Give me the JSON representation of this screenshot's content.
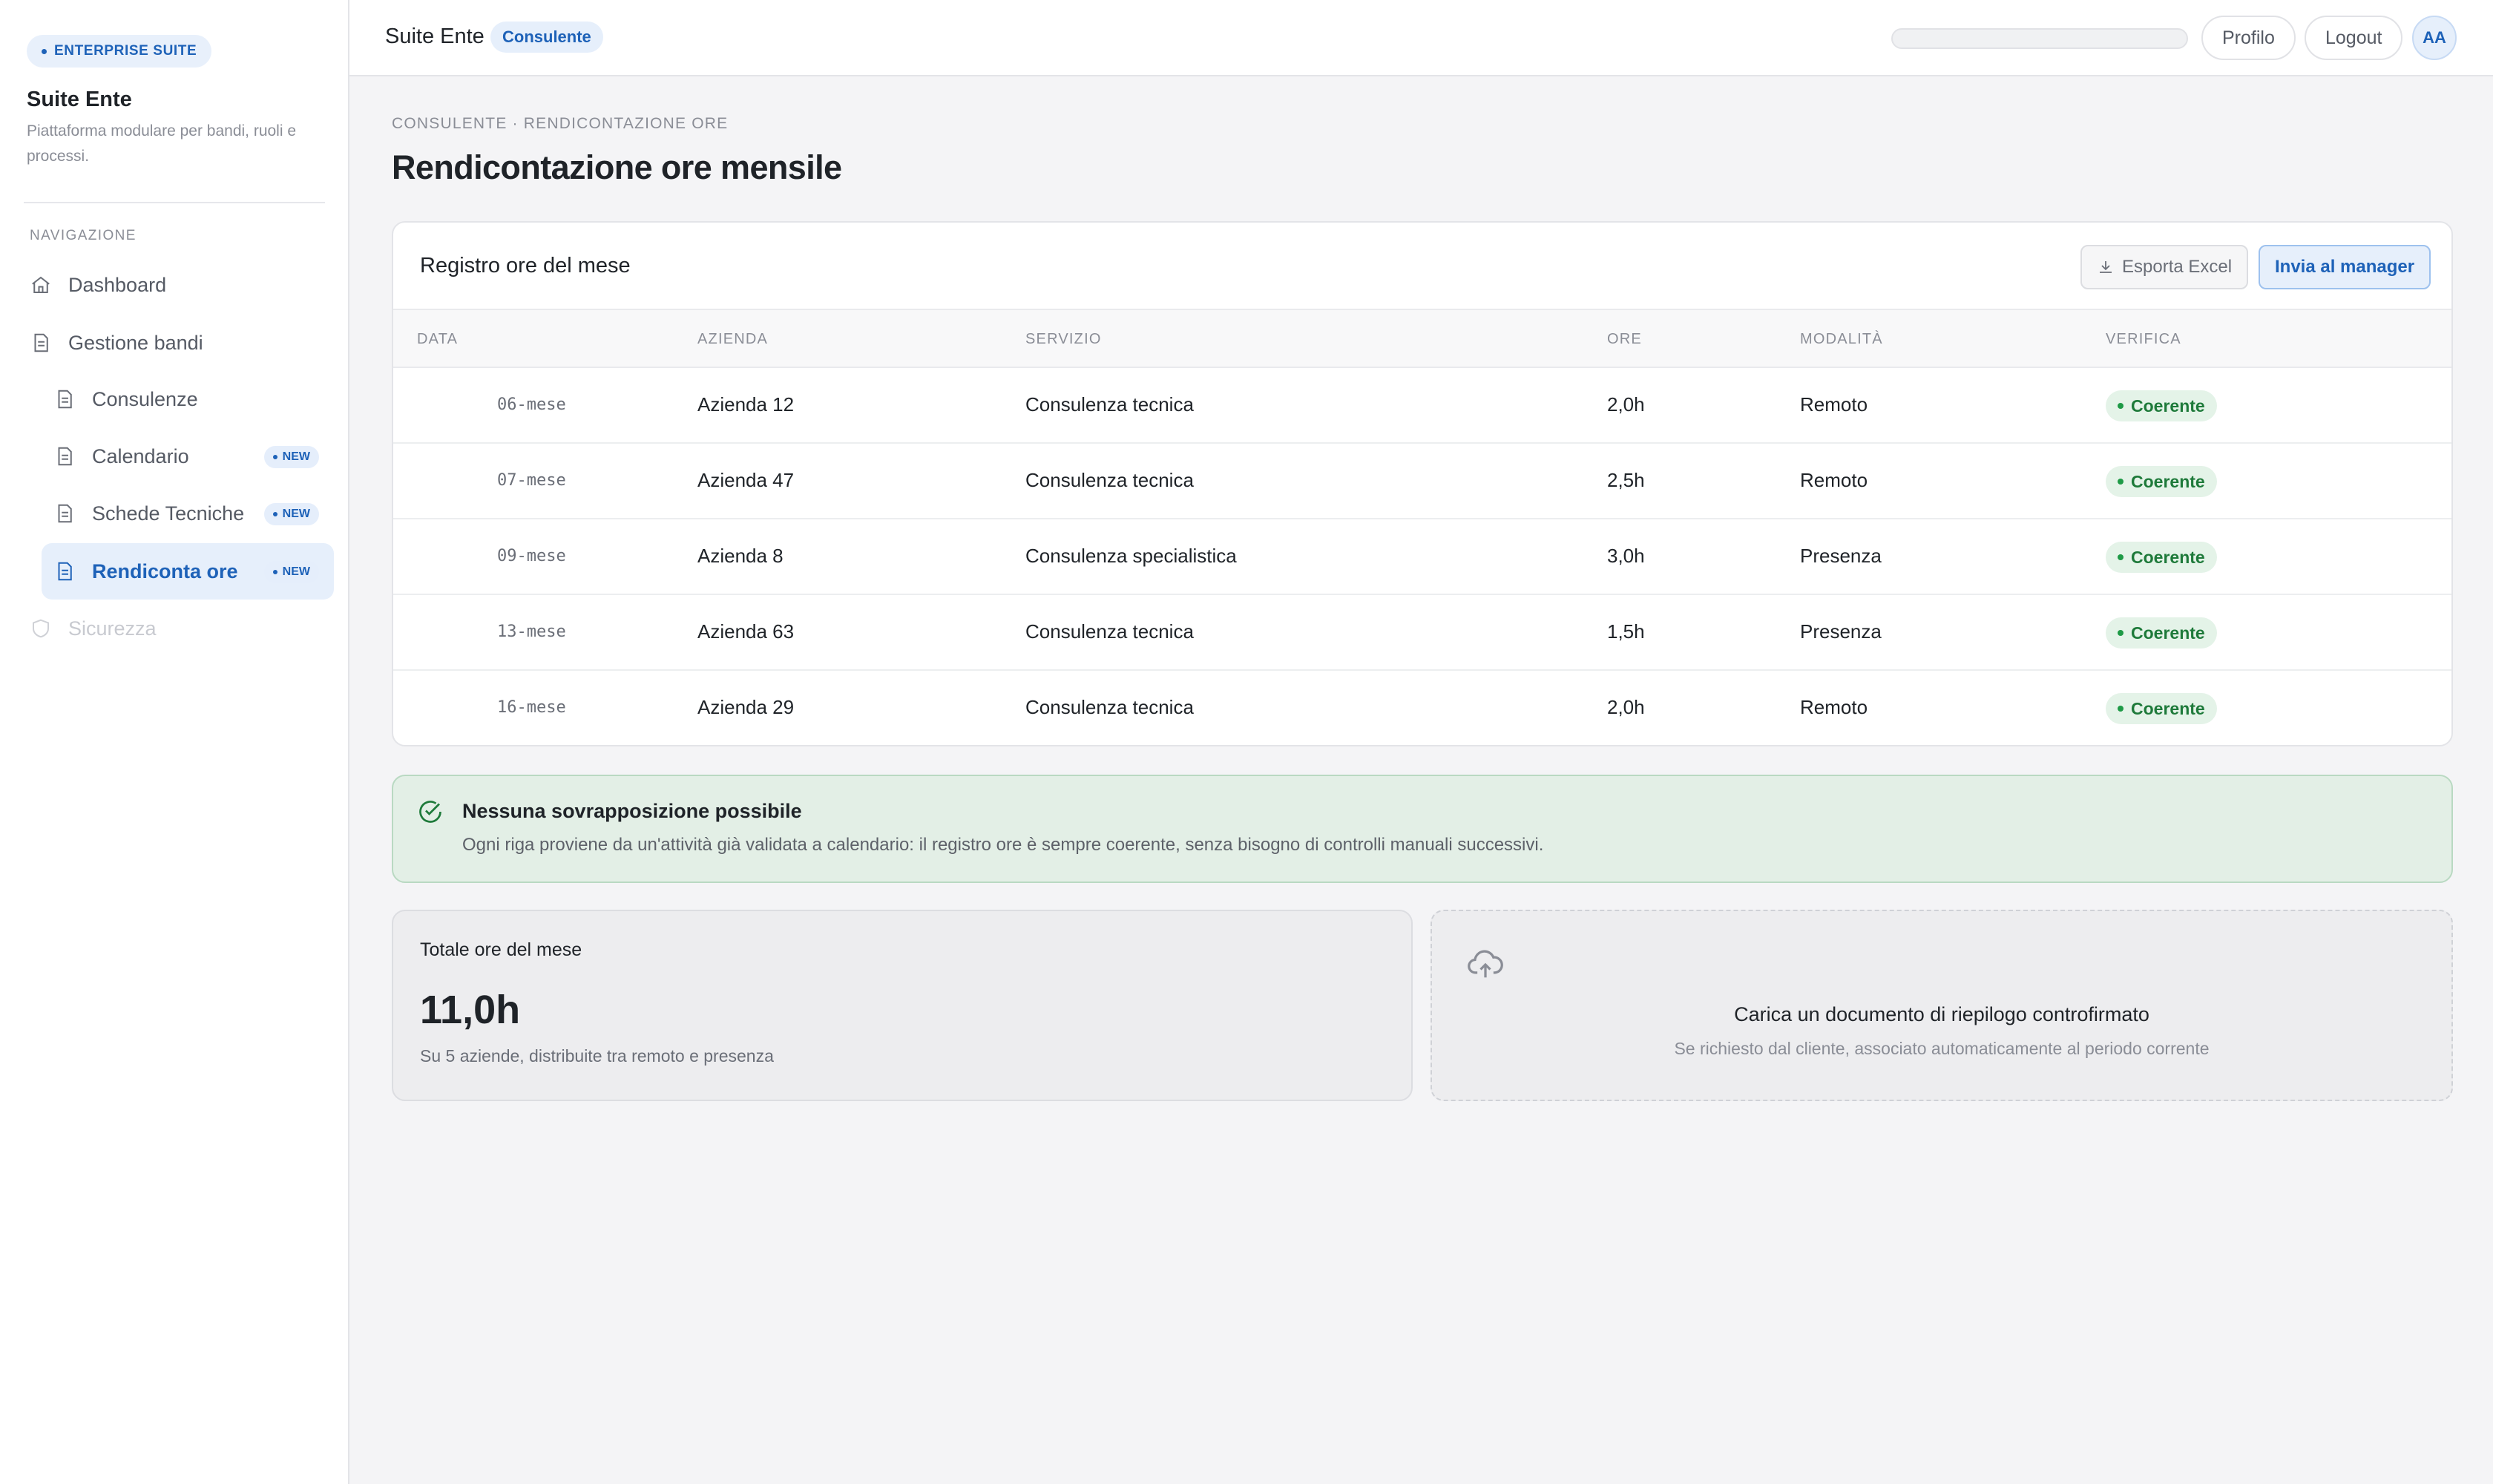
{
  "sidebar": {
    "badge": "ENTERPRISE SUITE",
    "title": "Suite Ente",
    "subtitle": "Piattaforma modulare per bandi, ruoli e processi.",
    "nav_heading": "NAVIGAZIONE",
    "items": [
      {
        "label": "Dashboard",
        "icon": "home-icon"
      },
      {
        "label": "Gestione bandi",
        "icon": "document-icon"
      },
      {
        "label": "Consulenze",
        "icon": "document-icon"
      },
      {
        "label": "Calendario",
        "icon": "document-icon",
        "badge": "NEW"
      },
      {
        "label": "Schede Tecniche",
        "icon": "document-icon",
        "badge": "NEW"
      },
      {
        "label": "Rendiconta ore",
        "icon": "document-icon",
        "badge": "NEW",
        "active": true
      },
      {
        "label": "Sicurezza",
        "icon": "shield-icon",
        "disabled": true
      }
    ]
  },
  "topbar": {
    "title": "Suite Ente",
    "role": "Consulente",
    "profile_label": "Profilo",
    "logout_label": "Logout",
    "avatar_initials": "AA"
  },
  "page": {
    "breadcrumb": "CONSULENTE · RENDICONTAZIONE ORE",
    "title": "Rendicontazione ore mensile"
  },
  "table": {
    "title": "Registro ore del mese",
    "export_label": "Esporta Excel",
    "send_label": "Invia al manager",
    "columns": [
      "DATA",
      "AZIENDA",
      "SERVIZIO",
      "ORE",
      "MODALITÀ",
      "VERIFICA"
    ],
    "rows": [
      {
        "data": "06-mese",
        "azienda": "Azienda 12",
        "servizio": "Consulenza tecnica",
        "ore": "2,0h",
        "modalita": "Remoto",
        "verifica": "Coerente"
      },
      {
        "data": "07-mese",
        "azienda": "Azienda 47",
        "servizio": "Consulenza tecnica",
        "ore": "2,5h",
        "modalita": "Remoto",
        "verifica": "Coerente"
      },
      {
        "data": "09-mese",
        "azienda": "Azienda 8",
        "servizio": "Consulenza specialistica",
        "ore": "3,0h",
        "modalita": "Presenza",
        "verifica": "Coerente"
      },
      {
        "data": "13-mese",
        "azienda": "Azienda 63",
        "servizio": "Consulenza tecnica",
        "ore": "1,5h",
        "modalita": "Presenza",
        "verifica": "Coerente"
      },
      {
        "data": "16-mese",
        "azienda": "Azienda 29",
        "servizio": "Consulenza tecnica",
        "ore": "2,0h",
        "modalita": "Remoto",
        "verifica": "Coerente"
      }
    ]
  },
  "alert": {
    "title": "Nessuna sovrapposizione possibile",
    "text": "Ogni riga proviene da un'attività già validata a calendario: il registro ore è sempre coerente, senza bisogno di controlli manuali successivi."
  },
  "summary": {
    "label": "Totale ore del mese",
    "value": "11,0h",
    "sub": "Su 5 aziende, distribuite tra remoto e presenza"
  },
  "upload": {
    "title": "Carica un documento di riepilogo controfirmato",
    "sub": "Se richiesto dal cliente, associato automaticamente al periodo corrente"
  },
  "colors": {
    "accent": "#1e62b8",
    "success": "#1e7a3a",
    "success_bg": "#e4f3e8"
  }
}
